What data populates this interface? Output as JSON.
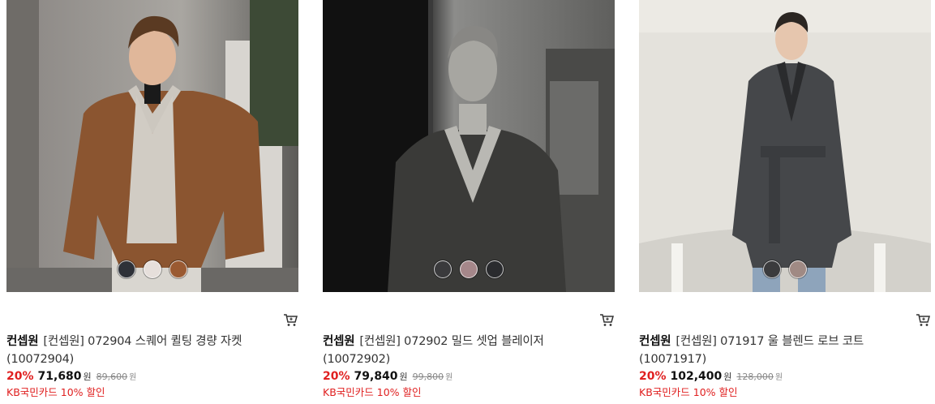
{
  "products": [
    {
      "brand": "컨셉원",
      "name": "[컨셉원] 072904 스퀘어 퀼팅 경량 자켓",
      "code": "(10072904)",
      "discount_rate": "20%",
      "sale_price": "71,680",
      "currency": "원",
      "original_price": "89,600",
      "promo": "KB국민카드 10% 할인",
      "swatches": [
        "#2e3138",
        "#e6dfdb",
        "#9a5a32"
      ]
    },
    {
      "brand": "컨셉원",
      "name": "[컨셉원] 072902 밀드 셋업 블레이저",
      "code": "(10072902)",
      "discount_rate": "20%",
      "sale_price": "79,840",
      "currency": "원",
      "original_price": "99,800",
      "promo": "KB국민카드 10% 할인",
      "swatches": [
        "#3a3a3c",
        "#a5878a",
        "#2a2b2e"
      ]
    },
    {
      "brand": "컨셉원",
      "name": "[컨셉원] 071917 울 블렌드 로브 코트",
      "code": "(10071917)",
      "discount_rate": "20%",
      "sale_price": "102,400",
      "currency": "원",
      "original_price": "128,000",
      "promo": "KB국민카드 10% 할인",
      "swatches": [
        "#3b3b3d",
        "#a08a84"
      ]
    }
  ],
  "icons": {
    "cart": "cart-icon"
  }
}
